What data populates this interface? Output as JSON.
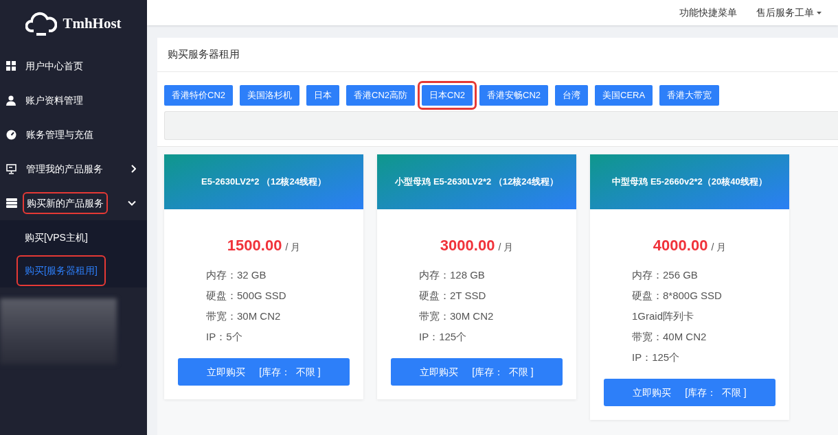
{
  "sidebar": {
    "logo": "TmhHost",
    "items": [
      {
        "label": "用户中心首页",
        "kind": "link",
        "highlighted": false
      },
      {
        "label": "账户资料管理",
        "kind": "link",
        "highlighted": false
      },
      {
        "label": "账务管理与充值",
        "kind": "link",
        "highlighted": false
      },
      {
        "label": "管理我的产品服务",
        "kind": "group",
        "expanded": false,
        "highlighted": false
      },
      {
        "label": "购买新的产品服务",
        "kind": "group",
        "expanded": true,
        "highlighted": true,
        "children": [
          {
            "label": "购买[VPS主机]",
            "selected": false,
            "highlighted": false
          },
          {
            "label": "购买[服务器租用]",
            "selected": true,
            "highlighted": true
          }
        ]
      }
    ],
    "blurred": true
  },
  "header": {
    "menus": [
      {
        "label": "功能快捷菜单",
        "dropdown": false
      },
      {
        "label": "售后服务工单",
        "dropdown": true
      }
    ]
  },
  "panel": {
    "title": "购买服务器租用",
    "tabs": [
      {
        "label": "香港特价CN2",
        "highlighted": false
      },
      {
        "label": "美国洛杉机",
        "highlighted": false
      },
      {
        "label": "日本",
        "highlighted": false
      },
      {
        "label": "香港CN2高防",
        "highlighted": false
      },
      {
        "label": "日本CN2",
        "highlighted": true
      },
      {
        "label": "香港安畅CN2",
        "highlighted": false
      },
      {
        "label": "台湾",
        "highlighted": false
      },
      {
        "label": "美国CERA",
        "highlighted": false
      },
      {
        "label": "香港大带宽",
        "highlighted": false
      }
    ],
    "products": [
      {
        "name": "E5-2630LV2*2 （12核24线程）",
        "price": "1500.00",
        "unit": "/ 月",
        "specs": [
          "内存：32 GB",
          "硬盘：500G SSD",
          "带宽：30M CN2",
          "IP：5个"
        ],
        "button": "立即购买",
        "stock": "[库存：  不限 ]"
      },
      {
        "name": "小型母鸡 E5-2630LV2*2 （12核24线程）",
        "price": "3000.00",
        "unit": "/ 月",
        "specs": [
          "内存：128 GB",
          "硬盘：2T SSD",
          "带宽：30M CN2",
          "IP：125个"
        ],
        "button": "立即购买",
        "stock": "[库存：  不限 ]"
      },
      {
        "name": "中型母鸡 E5-2660v2*2（20核40线程）",
        "price": "4000.00",
        "unit": "/ 月",
        "specs": [
          "内存：256 GB",
          "硬盘：8*800G SSD",
          "1Graid阵列卡",
          "带宽：40M CN2",
          "IP：125个"
        ],
        "button": "立即购买",
        "stock": "[库存：  不限 ]"
      }
    ]
  }
}
